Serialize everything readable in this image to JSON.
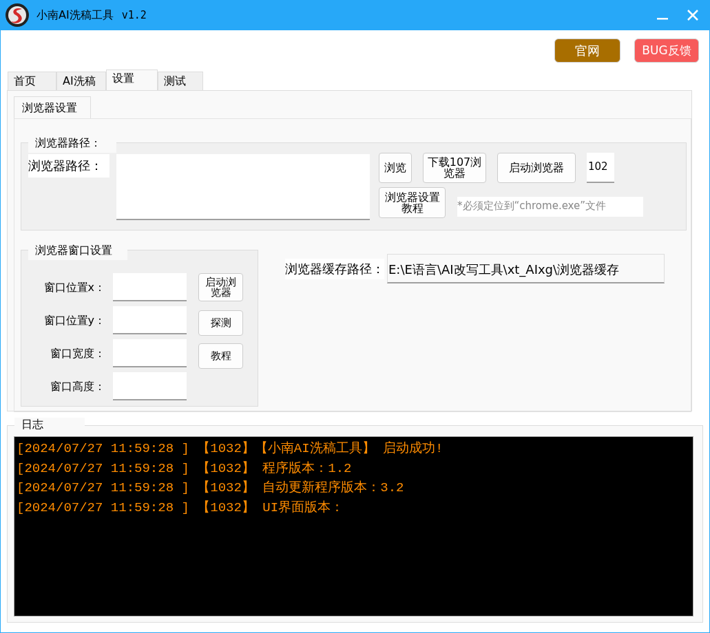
{
  "window": {
    "title": "小南AI洗稿工具",
    "version": "v1.2"
  },
  "header_buttons": [
    {
      "label": "官网",
      "kind": "site"
    },
    {
      "label": "BUG反馈",
      "kind": "report"
    }
  ],
  "tabs": [
    {
      "label": "首页",
      "selected": false
    },
    {
      "label": "AI洗稿",
      "selected": false
    },
    {
      "label": "设置",
      "selected": true
    },
    {
      "label": "测试",
      "selected": false
    }
  ],
  "subtabs": [
    {
      "label": "浏览器设置",
      "selected": true
    }
  ],
  "browser_path_group": {
    "title": "浏览器路径：",
    "label": "浏览器路径：",
    "buttons": [
      "浏览",
      "下载107浏览器",
      "启动浏览器"
    ],
    "version_value": "102",
    "tutorial_button": "浏览器设置教程",
    "note": "*必须定位到“chrome.exe”文件"
  },
  "window_group": {
    "title": "浏览器窗口设置",
    "fields": [
      {
        "label": "窗口位置x："
      },
      {
        "label": "窗口位置y："
      },
      {
        "label": "窗口宽度："
      },
      {
        "label": "窗口高度："
      }
    ],
    "buttons": [
      "启动浏览器",
      "探测",
      "教程"
    ]
  },
  "cache_path": {
    "label": "浏览器缓存路径：",
    "value": "E:\\E语言\\AI改写工具\\xt_AIxg\\浏览器缓存"
  },
  "log": {
    "title": "日志",
    "lines": [
      "[2024/07/27 11:59:28 ] 【1032】【小南AI洗稿工具】 启动成功!",
      "[2024/07/27 11:59:28 ] 【1032】 程序版本：1.2",
      "[2024/07/27 11:59:28 ] 【1032】 自动更新程序版本：3.2",
      "[2024/07/27 11:59:28 ] 【1032】 UI界面版本："
    ]
  }
}
